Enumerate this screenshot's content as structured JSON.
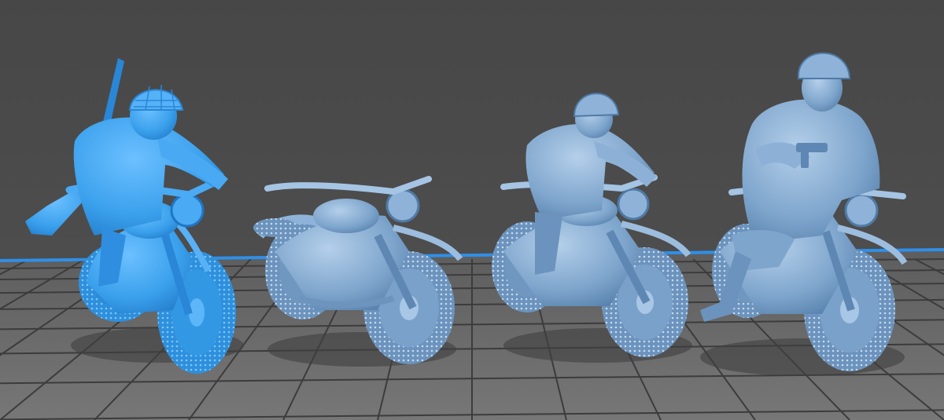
{
  "scene": {
    "background_color": "#4c4c4c",
    "floor_color": "#6a6a6a",
    "grid_color": "#3c3c3c",
    "build_plate_edge_color": "#2f8fe8"
  },
  "models": [
    {
      "name": "rider-with-rifle",
      "color": "#3aa0ec",
      "has_rider": true,
      "helmet": "netted"
    },
    {
      "name": "empty-motorcycle",
      "color": "#7ea5cc",
      "has_rider": false
    },
    {
      "name": "rider-crouched",
      "color": "#7ea5cc",
      "has_rider": true,
      "helmet": "smooth"
    },
    {
      "name": "rider-with-pistol",
      "color": "#7ea5cc",
      "has_rider": true,
      "helmet": "smooth"
    }
  ]
}
